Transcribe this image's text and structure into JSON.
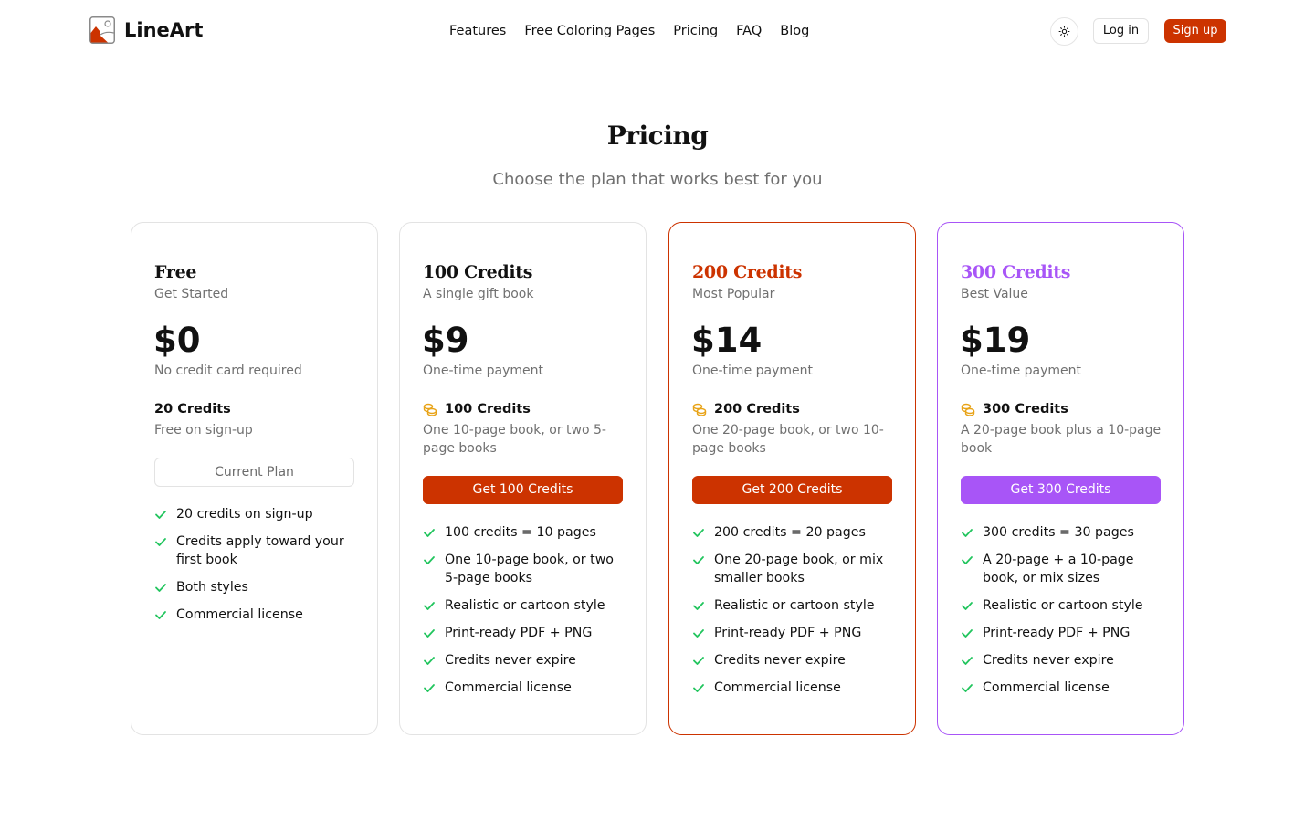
{
  "brand": {
    "name": "LineArt"
  },
  "nav": [
    "Features",
    "Free Coloring Pages",
    "Pricing",
    "FAQ",
    "Blog"
  ],
  "header": {
    "theme_icon": "sun-icon",
    "login_label": "Log in",
    "signup_label": "Sign up"
  },
  "hero": {
    "title": "Pricing",
    "subtitle": "Choose the plan that works best for you"
  },
  "colors": {
    "accent": "#cc3300",
    "purple": "#a855f7",
    "check": "#22c55e",
    "coin": "#e8a317"
  },
  "plans": [
    {
      "name": "Free",
      "tagline": "Get Started",
      "price": "$0",
      "price_note": "No credit card required",
      "credits_title": "20 Credits",
      "credits_desc": "Free on sign-up",
      "cta": "Current Plan",
      "features": [
        "20 credits on sign-up",
        "Credits apply toward your first book",
        "Both styles",
        "Commercial license"
      ]
    },
    {
      "name": "100 Credits",
      "tagline": "A single gift book",
      "price": "$9",
      "price_note": "One-time payment",
      "credits_title": "100 Credits",
      "credits_desc": "One 10-page book, or two 5-page books",
      "cta": "Get 100 Credits",
      "features": [
        "100 credits = 10 pages",
        "One 10-page book, or two 5-page books",
        "Realistic or cartoon style",
        "Print-ready PDF + PNG",
        "Credits never expire",
        "Commercial license"
      ]
    },
    {
      "name": "200 Credits",
      "tagline": "Most Popular",
      "price": "$14",
      "price_note": "One-time payment",
      "credits_title": "200 Credits",
      "credits_desc": "One 20-page book, or two 10-page books",
      "cta": "Get 200 Credits",
      "features": [
        "200 credits = 20 pages",
        "One 20-page book, or mix smaller books",
        "Realistic or cartoon style",
        "Print-ready PDF + PNG",
        "Credits never expire",
        "Commercial license"
      ]
    },
    {
      "name": "300 Credits",
      "tagline": "Best Value",
      "price": "$19",
      "price_note": "One-time payment",
      "credits_title": "300 Credits",
      "credits_desc": "A 20-page book plus a 10-page book",
      "cta": "Get 300 Credits",
      "features": [
        "300 credits = 30 pages",
        "A 20-page + a 10-page book, or mix sizes",
        "Realistic or cartoon style",
        "Print-ready PDF + PNG",
        "Credits never expire",
        "Commercial license"
      ]
    }
  ]
}
